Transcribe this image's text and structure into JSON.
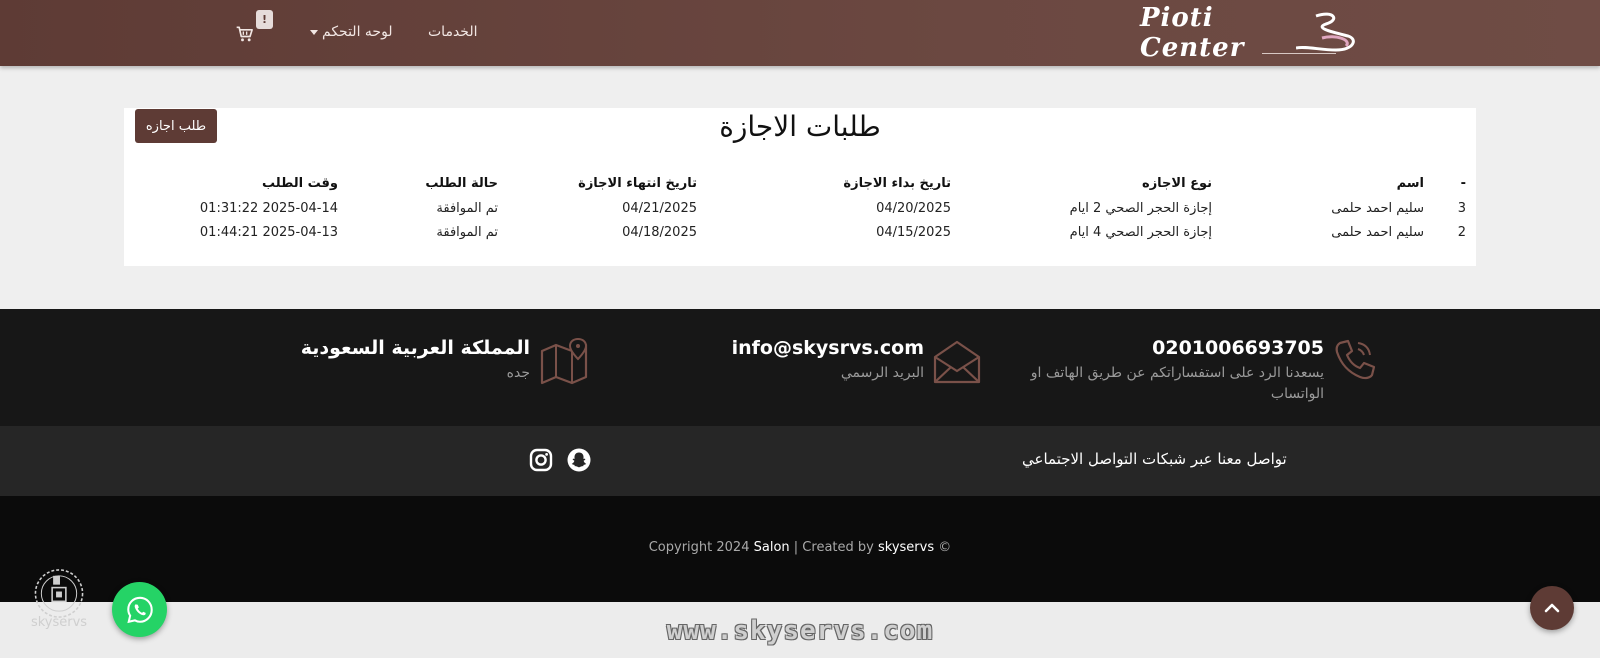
{
  "navbar": {
    "logo_text": "Pioti Center",
    "services": "الخدمات",
    "dashboard": "لوحه التحكم",
    "cart_badge": "!"
  },
  "page": {
    "title": "طلبات الاجازة",
    "request_button": "طلب اجازه"
  },
  "table": {
    "headers": {
      "idx": "-",
      "name": "اسم",
      "type": "نوع الاجازه",
      "start": "تاريخ بداء الاجازة",
      "end": "تاريخ انتهاء الاجازة",
      "status": "حالة الطلب",
      "time": "وقت الطلب"
    },
    "rows": [
      {
        "idx": "3",
        "name": "سليم احمد حلمى",
        "type": "إجازة الحجر الصحي 2 ايام",
        "start": "04/20/2025",
        "end": "04/21/2025",
        "status": "تم الموافقة",
        "time": "2025-04-14 01:31:22"
      },
      {
        "idx": "2",
        "name": "سليم احمد حلمى",
        "type": "إجازة الحجر الصحي 4 ايام",
        "start": "04/15/2025",
        "end": "04/18/2025",
        "status": "تم الموافقة",
        "time": "2025-04-13 01:44:21"
      }
    ]
  },
  "contact": {
    "phone": "0201006693705",
    "phone_note": "يسعدنا الرد على استفساراتكم عن طريق الهاتف او الواتساب",
    "email": "info@skysrvs.com",
    "email_note": "البريد الرسمي",
    "country": "المملكة العربية السعودية",
    "city": "جده"
  },
  "social": {
    "text": "تواصل معنا عبر شبكات التواصل الاجتماعي",
    "icons": [
      "snapchat-icon",
      "instagram-icon"
    ]
  },
  "footer": {
    "copyright_prefix": "Copyright 2024",
    "brand": "Salon",
    "created_by": "| Created by",
    "author": "skyservs",
    "symbol": "©",
    "watermark": "www.skyservs.com",
    "badge_text": "skyservs"
  },
  "colors": {
    "brand": "#5e3b35",
    "approved": "#1e9a2c",
    "whatsapp": "#25d366"
  }
}
